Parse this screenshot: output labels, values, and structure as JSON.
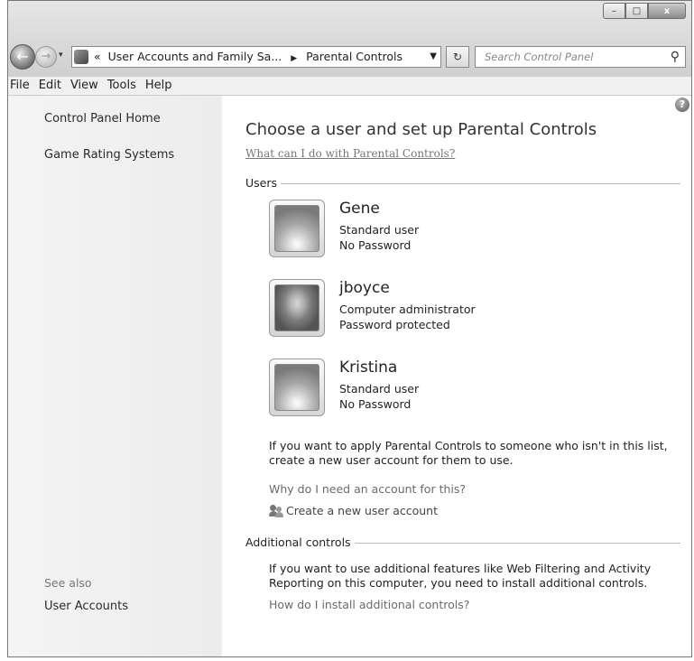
{
  "window": {
    "caption": {
      "minimize": "–",
      "maximize": "□",
      "close": "x"
    }
  },
  "navbar": {
    "back_icon": "back-arrow-icon",
    "forward_icon": "forward-arrow-icon",
    "history_glyph": "▾",
    "address": {
      "overflow": "«",
      "crumbs": [
        "User Accounts and Family Sa...",
        "Parental Controls"
      ],
      "separator": "▶",
      "dropdown": "▼"
    },
    "refresh_glyph": "↻",
    "search": {
      "placeholder": "Search Control Panel",
      "icon": "⚲"
    }
  },
  "menu": [
    "File",
    "Edit",
    "View",
    "Tools",
    "Help"
  ],
  "sidebar": {
    "links": [
      "Control Panel Home",
      "Game Rating Systems"
    ],
    "see_also_label": "See also",
    "see_also_links": [
      "User Accounts"
    ]
  },
  "main": {
    "help_glyph": "?",
    "title": "Choose a user and set up Parental Controls",
    "what_link": "What can I do with Parental Controls?",
    "users_section": "Users",
    "users": [
      {
        "name": "Gene",
        "type": "Standard user",
        "password": "No Password",
        "picture": "flower"
      },
      {
        "name": "jboyce",
        "type": "Computer administrator",
        "password": "Password protected",
        "picture": "photo"
      },
      {
        "name": "Kristina",
        "type": "Standard user",
        "password": "No Password",
        "picture": "flower"
      }
    ],
    "new_user_text": "If you want to apply Parental Controls to someone who isn't in this list, create a new user account for them to use.",
    "why_link": "Why do I need an account for this?",
    "create_link": "Create a new user account",
    "additional_section": "Additional controls",
    "additional_text": "If you want to use additional features like Web Filtering and Activity Reporting on this computer, you need to install additional controls.",
    "install_link": "How do I install additional controls?"
  }
}
